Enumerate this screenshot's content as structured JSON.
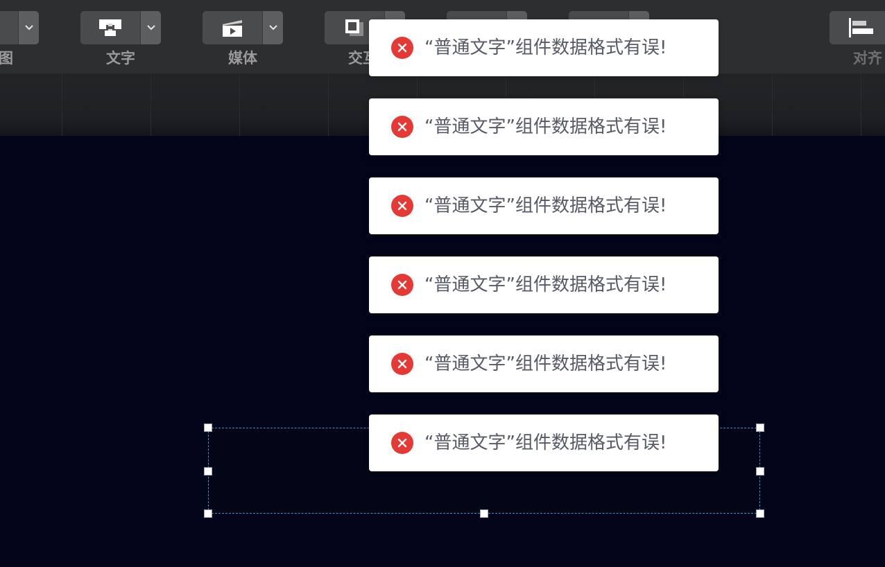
{
  "toolbar": {
    "groups": [
      {
        "label": "图",
        "icon": "image-icon"
      },
      {
        "label": "文字",
        "icon": "text-icon"
      },
      {
        "label": "媒体",
        "icon": "media-icon"
      },
      {
        "label": "交互",
        "icon": "interaction-icon"
      },
      {
        "label": "",
        "icon": "unknown-icon"
      },
      {
        "label": "",
        "icon": "unknown-icon"
      },
      {
        "label": "对齐",
        "icon": "align-left-icon"
      }
    ]
  },
  "toasts": [
    {
      "message": "“普通文字”组件数据格式有误!"
    },
    {
      "message": "“普通文字”组件数据格式有误!"
    },
    {
      "message": "“普通文字”组件数据格式有误!"
    },
    {
      "message": "“普通文字”组件数据格式有误!"
    },
    {
      "message": "“普通文字”组件数据格式有误!"
    },
    {
      "message": "“普通文字”组件数据格式有误!"
    }
  ],
  "colors": {
    "toolbar_bg": "#2d2e30",
    "canvas_bg": "#02051a",
    "error_red": "#e53935",
    "toast_text": "#555a66",
    "selection_border": "#4a8fc9"
  }
}
